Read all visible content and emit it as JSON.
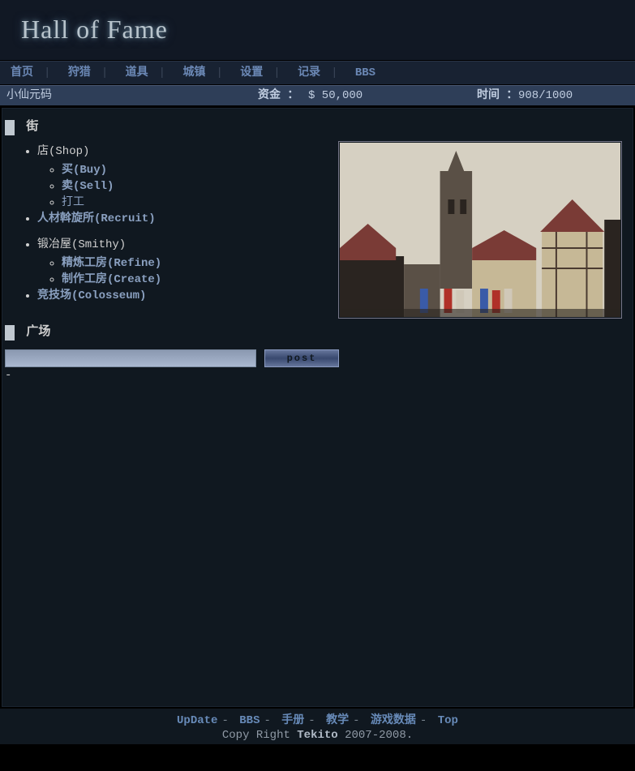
{
  "header": {
    "title": "Hall of Fame"
  },
  "nav": {
    "items": [
      "首页",
      "狩猎",
      "道具",
      "城镇",
      "设置",
      "记录",
      "BBS"
    ]
  },
  "status": {
    "player_name": "小仙元码",
    "money_label": "资金 ：",
    "money_value": "$  50,000",
    "time_label": "时间 ：",
    "time_value": "908/1000"
  },
  "sections": {
    "street": "街",
    "plaza": "广场"
  },
  "street": {
    "shop_header": "店(Shop)",
    "shop": {
      "buy": "买(Buy)",
      "sell": "卖(Sell)",
      "work": "打工"
    },
    "recruit": "人材斡旋所(Recruit)",
    "smithy_header": "锻冶屋(Smithy)",
    "smithy": {
      "refine": "精炼工房(Refine)",
      "create": "制作工房(Create)"
    },
    "colosseum": "竞技场(Colosseum)"
  },
  "plaza": {
    "input_value": "",
    "post_label": "post"
  },
  "footer": {
    "links": [
      "UpDate",
      "BBS",
      "手册",
      "教学",
      "游戏数据",
      "Top"
    ],
    "copyright_prefix": "Copy Right ",
    "copyright_name": "Tekito",
    "copyright_years": " 2007-2008."
  }
}
